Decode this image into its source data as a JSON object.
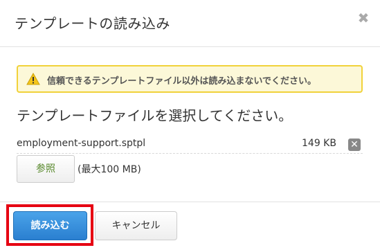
{
  "dialog": {
    "title": "テンプレートの読み込み",
    "close_icon": "close-icon"
  },
  "warning": {
    "icon": "warning-triangle-icon",
    "text": "信頼できるテンプレートファイル以外は読み込まないでください。",
    "colors": {
      "background": "#fcf8d8",
      "border": "#f1d23a"
    }
  },
  "prompt": "テンプレートファイルを選択してください。",
  "file": {
    "name": "employment-support.sptpl",
    "size": "149 KB",
    "remove_icon": "remove-icon"
  },
  "browse": {
    "label": "参照",
    "note": "(最大100 MB)"
  },
  "footer": {
    "import_label": "読み込む",
    "cancel_label": "キャンセル",
    "highlight_color": "#e60012",
    "primary_color": "#2a7fd0"
  }
}
